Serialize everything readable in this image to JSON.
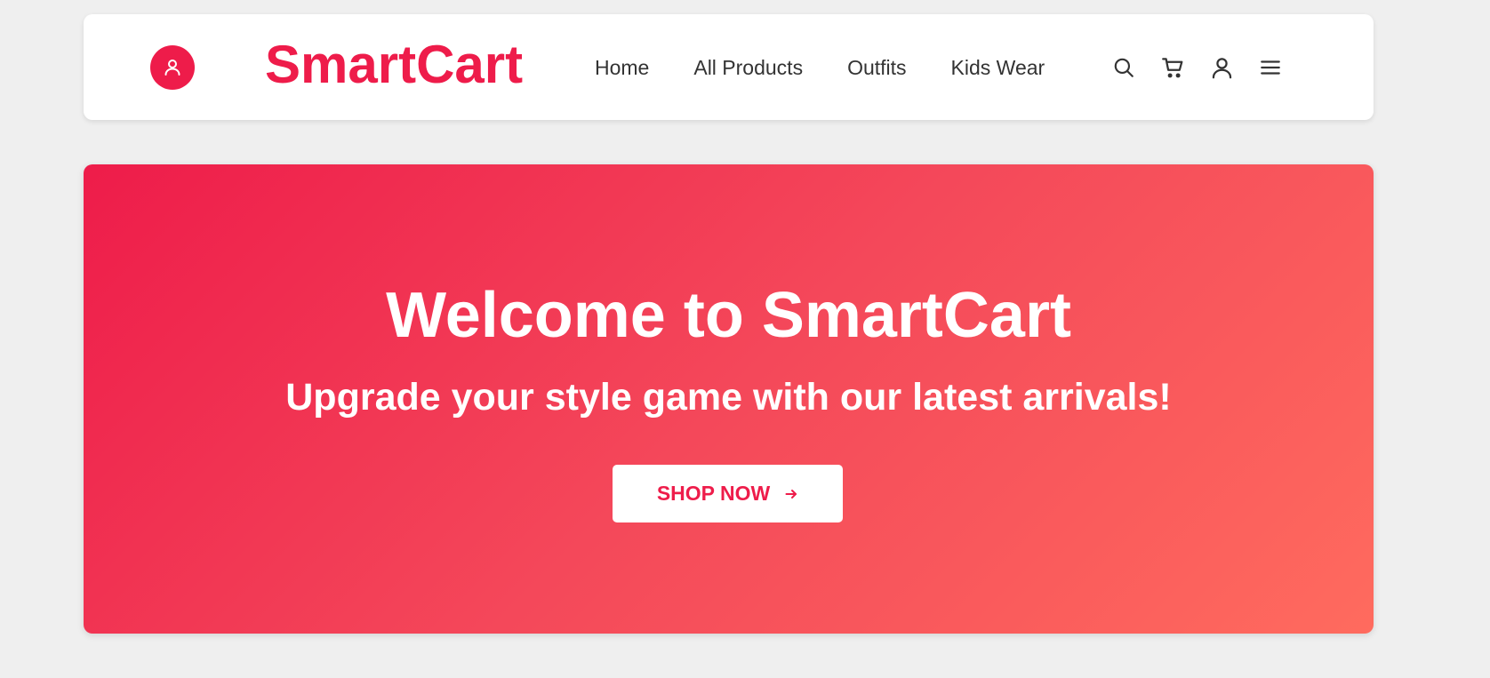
{
  "header": {
    "brand": "SmartCart",
    "logo_icon": "user-icon",
    "nav": [
      {
        "label": "Home"
      },
      {
        "label": "All Products"
      },
      {
        "label": "Outfits"
      },
      {
        "label": "Kids Wear"
      }
    ],
    "icons": [
      "search-icon",
      "cart-icon",
      "user-icon",
      "menu-icon"
    ]
  },
  "hero": {
    "title": "Welcome to SmartCart",
    "subtitle": "Upgrade your style game with our latest arrivals!",
    "cta_label": "SHOP NOW",
    "cta_icon": "arrow-right-icon"
  },
  "colors": {
    "brand": "#ee1c4a",
    "gradient_start": "#ee1c4a",
    "gradient_end": "#ff6b5e",
    "page_background": "#efefef",
    "text_dark": "#333333"
  }
}
